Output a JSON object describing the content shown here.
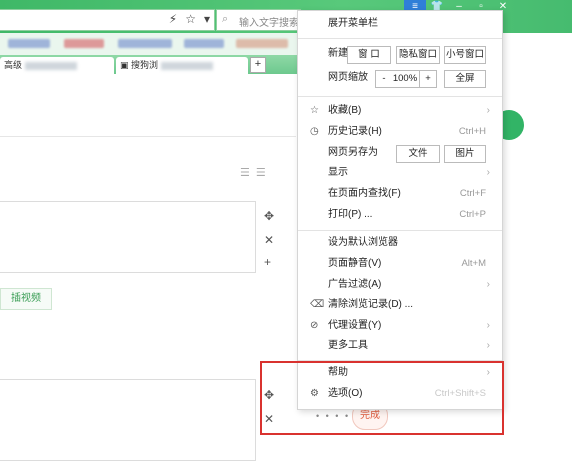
{
  "address_bar": {
    "icons": [
      "lightning-icon",
      "star-icon",
      "dropdown-icon"
    ]
  },
  "search": {
    "placeholder": "输入文字搜索"
  },
  "tabs": [
    {
      "label": "高级"
    },
    {
      "label": "搜狗浏"
    }
  ],
  "page": {
    "video_button": "插视频",
    "done_button": "完成",
    "dots": "• • • • •"
  },
  "menu": {
    "expand_menubar": "展开菜单栏",
    "new_label": "新建",
    "new_window": "窗 口",
    "private_window": "隐私窗口",
    "small_window": "小号窗口",
    "zoom_label": "网页缩放",
    "zoom_minus": "-",
    "zoom_value": "100%",
    "zoom_plus": "+",
    "fullscreen": "全屏",
    "favorites": "收藏(B)",
    "history": "历史记录(H)",
    "history_shortcut": "Ctrl+H",
    "save_as": "网页另存为",
    "save_file": "文件",
    "save_image": "图片",
    "display": "显示",
    "find_in_page": "在页面内查找(F)",
    "find_shortcut": "Ctrl+F",
    "print": "打印(P) ...",
    "print_shortcut": "Ctrl+P",
    "set_default": "设为默认浏览器",
    "mute_page": "页面静音(V)",
    "mute_shortcut": "Alt+M",
    "ad_filter": "广告过滤(A)",
    "clear_records": "清除浏览记录(D) ...",
    "proxy": "代理设置(Y)",
    "more_tools": "更多工具",
    "help": "帮助",
    "options": "选项(O)",
    "options_shortcut": "Ctrl+Shift+S"
  },
  "colors": {
    "chrome_green": "#46bb6f",
    "highlight_red": "#d9322f",
    "done_orange": "#e05a3c"
  }
}
